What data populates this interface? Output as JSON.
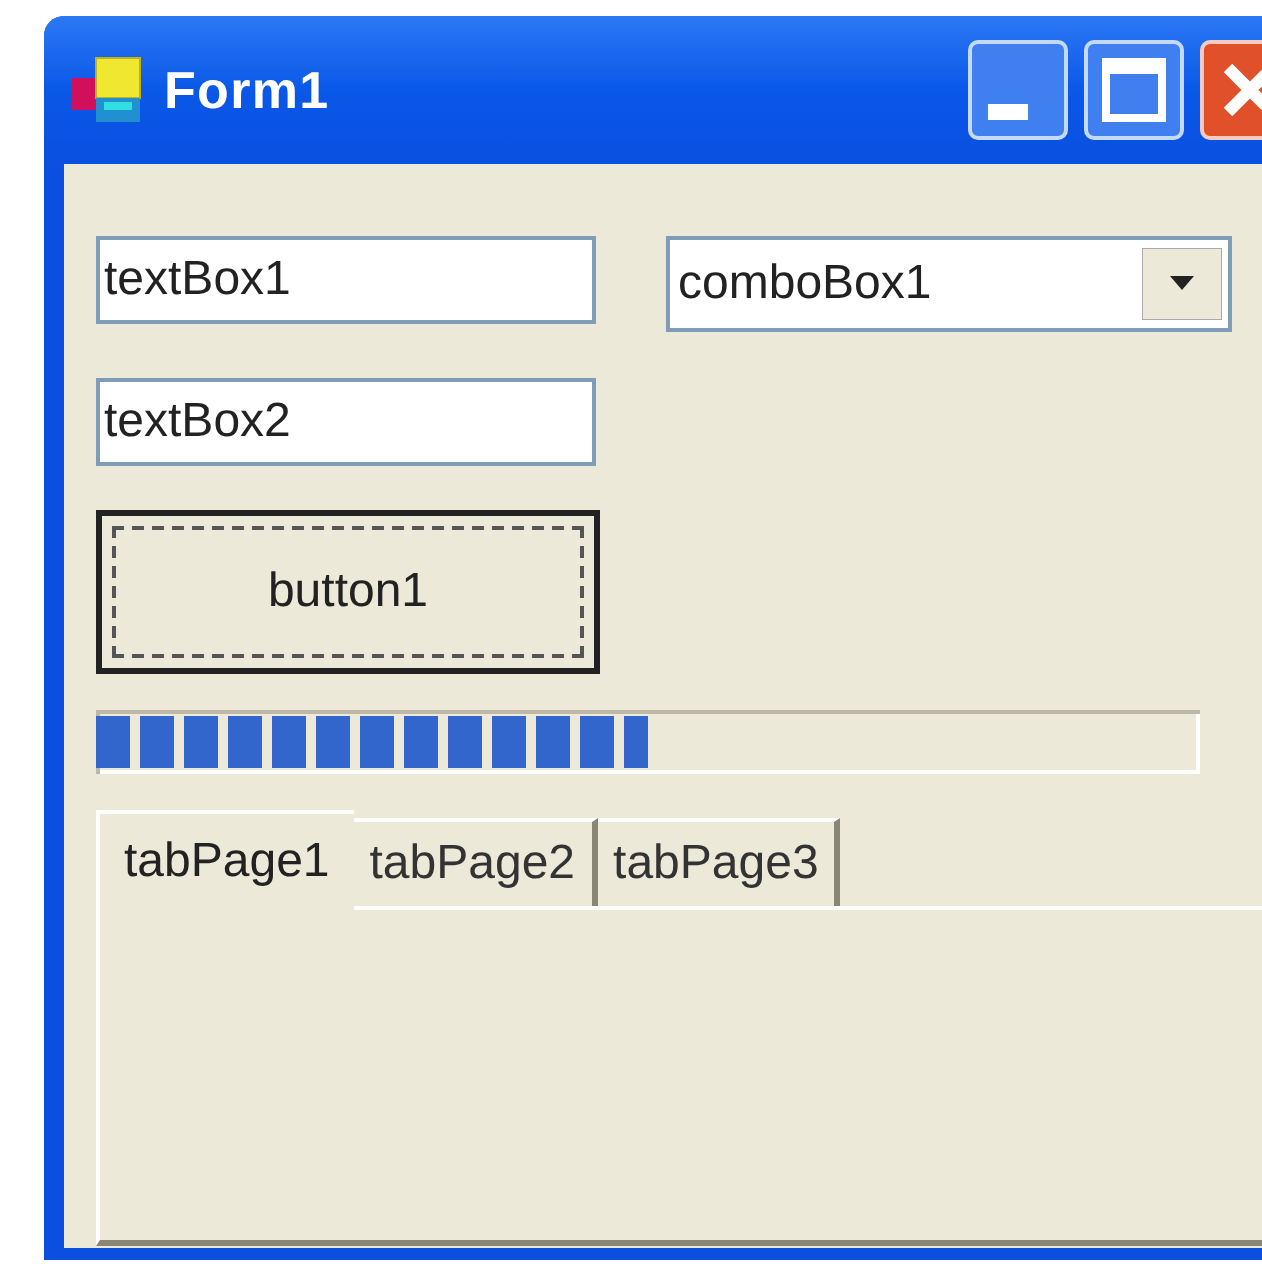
{
  "window": {
    "title": "Form1"
  },
  "textboxes": [
    {
      "value": "textBox1"
    },
    {
      "value": "textBox2"
    }
  ],
  "combobox": {
    "value": "comboBox1"
  },
  "button": {
    "label": "button1"
  },
  "progress": {
    "level": 0.5
  },
  "tabs": [
    {
      "label": "tabPage1",
      "selected": true
    },
    {
      "label": "tabPage2",
      "selected": false
    },
    {
      "label": "tabPage3",
      "selected": false
    }
  ]
}
